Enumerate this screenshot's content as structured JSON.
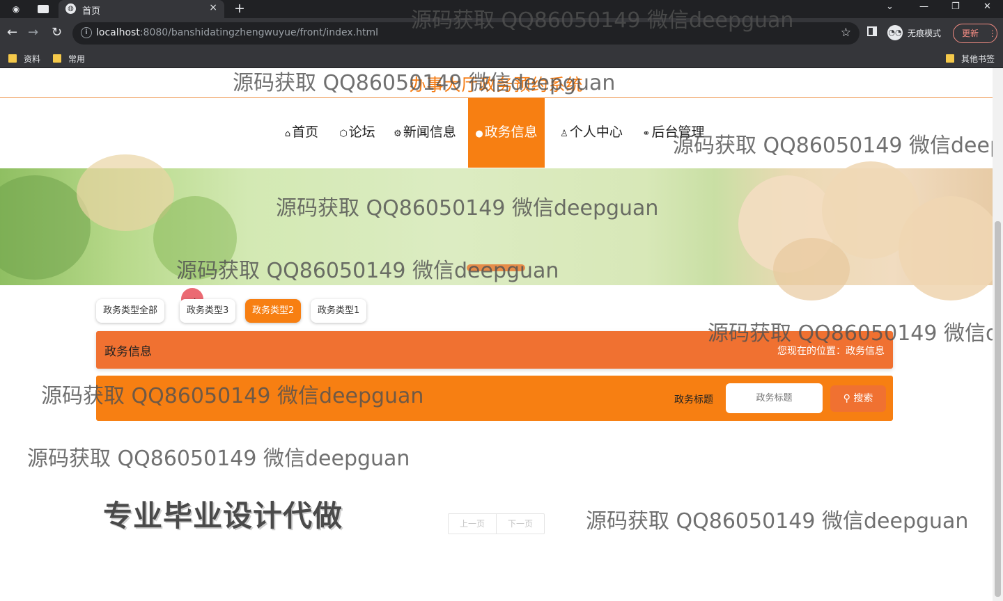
{
  "browser": {
    "tab_title": "首页",
    "tab_close": "×",
    "new_tab": "+",
    "url_host": "localhost",
    "url_rest": ":8080/banshidatingzhengwuyue/front/index.html",
    "incognito_label": "无痕模式",
    "update_label": "更新",
    "bookmarks": [
      "资料",
      "常用"
    ],
    "other_bookmarks": "其他书签"
  },
  "site": {
    "title": "办事大厅政务预约系统"
  },
  "menu": [
    {
      "icon": "⌂",
      "label": "首页"
    },
    {
      "icon": "⬡",
      "label": "论坛"
    },
    {
      "icon": "⚙",
      "label": "新闻信息"
    },
    {
      "icon": "●",
      "label": "政务信息",
      "active": true
    },
    {
      "icon": "♙",
      "label": "个人中心"
    },
    {
      "icon": "⚭",
      "label": "后台管理"
    }
  ],
  "filters": [
    {
      "label": "政务类型全部",
      "active": false
    },
    {
      "label": "政务类型3",
      "active": false
    },
    {
      "label": "政务类型2",
      "active": true
    },
    {
      "label": "政务类型1",
      "active": false
    }
  ],
  "section": {
    "title": "政务信息",
    "breadcrumb": "您现在的位置：政务信息"
  },
  "search": {
    "label": "政务标题",
    "placeholder": "政务标题",
    "button": "搜索"
  },
  "pager": {
    "prev": "上一页",
    "next": "下一页"
  },
  "ad_text": "专业毕业设计代做",
  "watermark": "源码获取 QQ86050149 微信deepguan",
  "colors": {
    "accent": "#f77f12",
    "section": "#f07131",
    "title": "#f57c14"
  }
}
